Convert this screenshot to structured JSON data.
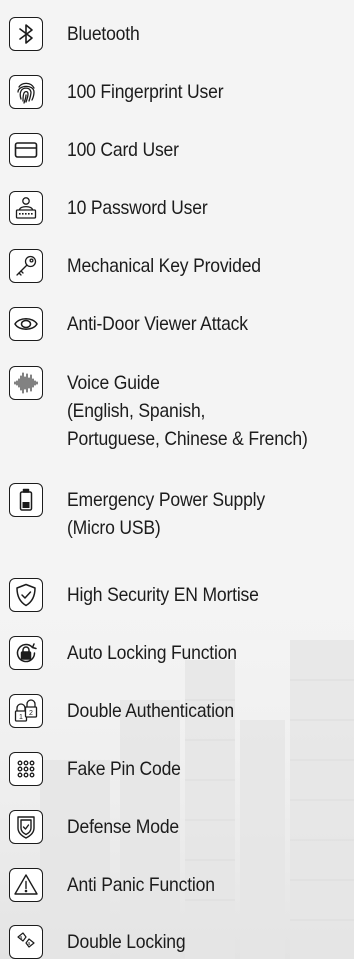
{
  "features": [
    {
      "icon": "bluetooth-icon",
      "lines": [
        "Bluetooth"
      ]
    },
    {
      "icon": "fingerprint-icon",
      "lines": [
        "100 Fingerprint User"
      ]
    },
    {
      "icon": "card-icon",
      "lines": [
        "100 Card User"
      ]
    },
    {
      "icon": "password-user-icon",
      "lines": [
        "10 Password User"
      ]
    },
    {
      "icon": "mechanical-key-icon",
      "lines": [
        "Mechanical Key Provided"
      ]
    },
    {
      "icon": "eye-icon",
      "lines": [
        "Anti-Door Viewer Attack"
      ]
    },
    {
      "icon": "voice-waveform-icon",
      "lines": [
        "Voice Guide",
        "(English, Spanish,",
        "Portuguese, Chinese & French)"
      ]
    },
    {
      "icon": "battery-icon",
      "lines": [
        "Emergency Power Supply",
        "(Micro USB)"
      ]
    },
    {
      "icon": "shield-check-icon",
      "lines": [
        "High Security EN Mortise"
      ]
    },
    {
      "icon": "auto-lock-icon",
      "lines": [
        "Auto Locking Function"
      ]
    },
    {
      "icon": "double-authentication-icon",
      "lines": [
        "Double Authentication"
      ]
    },
    {
      "icon": "keypad-icon",
      "lines": [
        "Fake Pin Code"
      ]
    },
    {
      "icon": "defense-shield-icon",
      "lines": [
        "Defense Mode"
      ]
    },
    {
      "icon": "warning-triangle-icon",
      "lines": [
        "Anti Panic Function"
      ]
    },
    {
      "icon": "double-lock-icon",
      "lines": [
        "Double Locking"
      ]
    }
  ]
}
